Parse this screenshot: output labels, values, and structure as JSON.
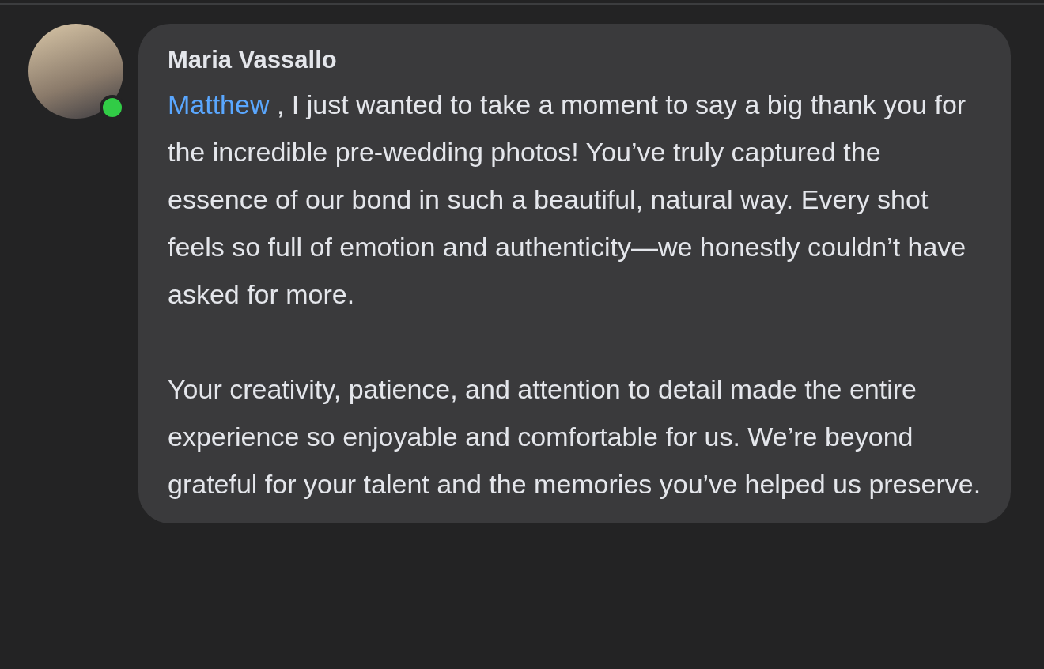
{
  "comment": {
    "author": "Maria Vassallo",
    "online": true,
    "mention": "Matthew",
    "paragraphs": [
      " , I just wanted to take a moment to say a big thank you for the incredible pre-wedding photos! You’ve truly captured the essence of our bond in such a beautiful, natural way. Every shot feels so full of emotion and authenticity—we honestly couldn’t have asked for more.",
      "Your creativity, patience, and attention to detail made the entire experience so enjoyable and comfortable for us. We’re beyond grateful for your talent and the memories you’ve helped us preserve."
    ]
  }
}
